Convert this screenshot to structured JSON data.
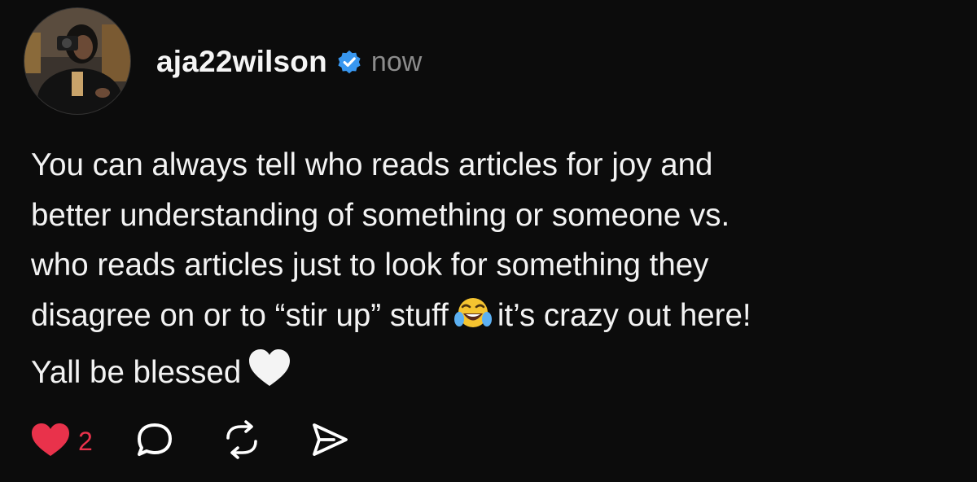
{
  "post": {
    "author": {
      "username": "aja22wilson",
      "verified": true,
      "timestamp": "now"
    },
    "body_lines": [
      "You can always tell who reads articles for joy and",
      "better understanding of something or someone vs.",
      "who reads articles just to look for something they",
      "disagree on or to “stir up” stuff",
      "it’s crazy out here!",
      "Yall be blessed"
    ],
    "emojis": [
      "face-with-tears-of-joy",
      "white-heart"
    ],
    "actions": {
      "like_count": "2",
      "liked": true,
      "icons": [
        "heart-icon",
        "reply-icon",
        "repost-icon",
        "share-icon"
      ]
    }
  },
  "colors": {
    "background": "#0c0c0c",
    "text": "#f3f3f3",
    "muted": "#8c8c8c",
    "verified": "#3897f0",
    "like": "#e9324b"
  }
}
